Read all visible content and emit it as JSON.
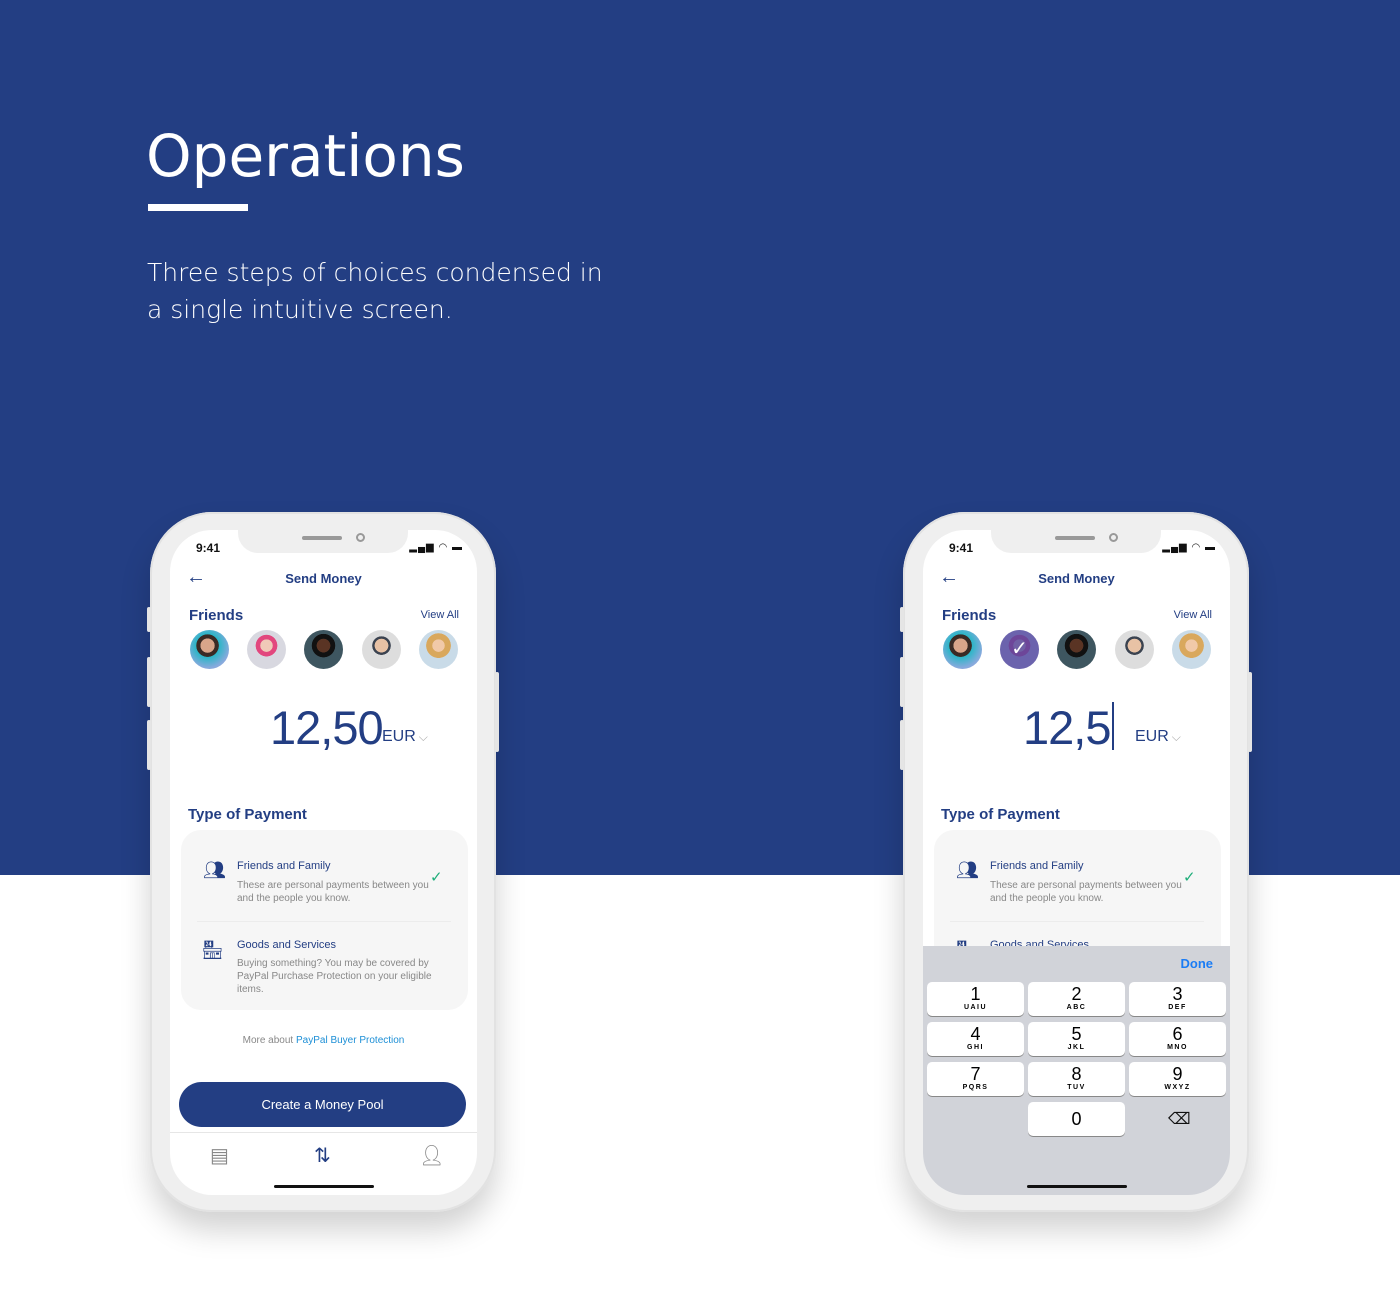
{
  "header": {
    "title": "Operations",
    "subtitle": "Three steps of choices condensed in a single intuitive screen."
  },
  "colors": {
    "brand": "#233e83",
    "link": "#1d8fd6",
    "check": "#1fae7a",
    "done": "#1a7cf5"
  },
  "phones": [
    {
      "status_time": "9:41",
      "nav_title": "Send Money",
      "friends_label": "Friends",
      "view_all": "View All",
      "selected_friend_index": null,
      "amount": "12,50",
      "currency": "EUR",
      "type_label": "Type of Payment",
      "options": [
        {
          "icon": "friends-icon",
          "title": "Friends and Family",
          "desc": "These are personal payments between you and the people you know.",
          "selected": true
        },
        {
          "icon": "store-icon",
          "title": "Goods and Services",
          "desc": "Buying something? You may be covered by PayPal Purchase Protection on your eligible items.",
          "selected": false
        }
      ],
      "more_prefix": "More about",
      "more_link": "PayPal Buyer Protection",
      "cta": "Create a Money Pool",
      "tabs": [
        "list-icon",
        "transfer-icon",
        "profile-icon"
      ]
    },
    {
      "status_time": "9:41",
      "nav_title": "Send Money",
      "friends_label": "Friends",
      "view_all": "View All",
      "selected_friend_index": 1,
      "amount": "12,5",
      "currency": "EUR",
      "type_label": "Type of Payment",
      "options": [
        {
          "icon": "friends-icon",
          "title": "Friends and Family",
          "desc": "These are personal payments between you and the people you know.",
          "selected": true
        },
        {
          "icon": "store-icon",
          "title": "Goods and Services"
        }
      ],
      "keyboard": {
        "done": "Done",
        "keys": [
          {
            "n": "1",
            "l": "UAIU"
          },
          {
            "n": "2",
            "l": "ABC"
          },
          {
            "n": "3",
            "l": "DEF"
          },
          {
            "n": "4",
            "l": "GHI"
          },
          {
            "n": "5",
            "l": "JKL"
          },
          {
            "n": "6",
            "l": "MNO"
          },
          {
            "n": "7",
            "l": "PQRS"
          },
          {
            "n": "8",
            "l": "TUV"
          },
          {
            "n": "9",
            "l": "WXYZ"
          },
          {
            "n": "0",
            "l": ""
          }
        ]
      }
    }
  ]
}
